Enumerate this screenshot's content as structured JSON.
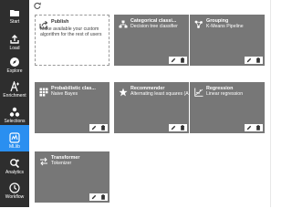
{
  "sidebar": {
    "items": [
      {
        "label": "Start",
        "icon": "folder-icon"
      },
      {
        "label": "Load",
        "icon": "upload-icon"
      },
      {
        "label": "Explore",
        "icon": "compass-icon"
      },
      {
        "label": "Enrichment",
        "icon": "enrichment-icon"
      },
      {
        "label": "Selections",
        "icon": "selections-icon"
      },
      {
        "label": "MLlib",
        "icon": "mllib-icon"
      },
      {
        "label": "Analytics",
        "icon": "analytics-icon"
      },
      {
        "label": "Workflow",
        "icon": "workflow-icon"
      }
    ],
    "active": "MLlib"
  },
  "publish": {
    "title": "Publish",
    "description": "Make available your custom algorithm for the rest of users"
  },
  "cards": [
    {
      "title": "Categorical classi...",
      "subtitle": "Decision tree classifier",
      "icon": "tree-icon"
    },
    {
      "title": "Grouping",
      "subtitle": "K-Means Pipeline",
      "icon": "cluster-icon"
    },
    {
      "title": "Probabilistic clas...",
      "subtitle": "Naive Bayes",
      "icon": "grid-icon"
    },
    {
      "title": "Recommender",
      "subtitle": "Alternating least squares (ALS)",
      "icon": "star-icon"
    },
    {
      "title": "Regression",
      "subtitle": "Linear regression",
      "icon": "regression-icon"
    },
    {
      "title": "Transformer",
      "subtitle": "Tokenizer",
      "icon": "transformer-icon"
    }
  ],
  "colors": {
    "sidebar_bg": "#2e2e2e",
    "active_bg": "#2a8ff0",
    "card_bg": "#777777"
  }
}
